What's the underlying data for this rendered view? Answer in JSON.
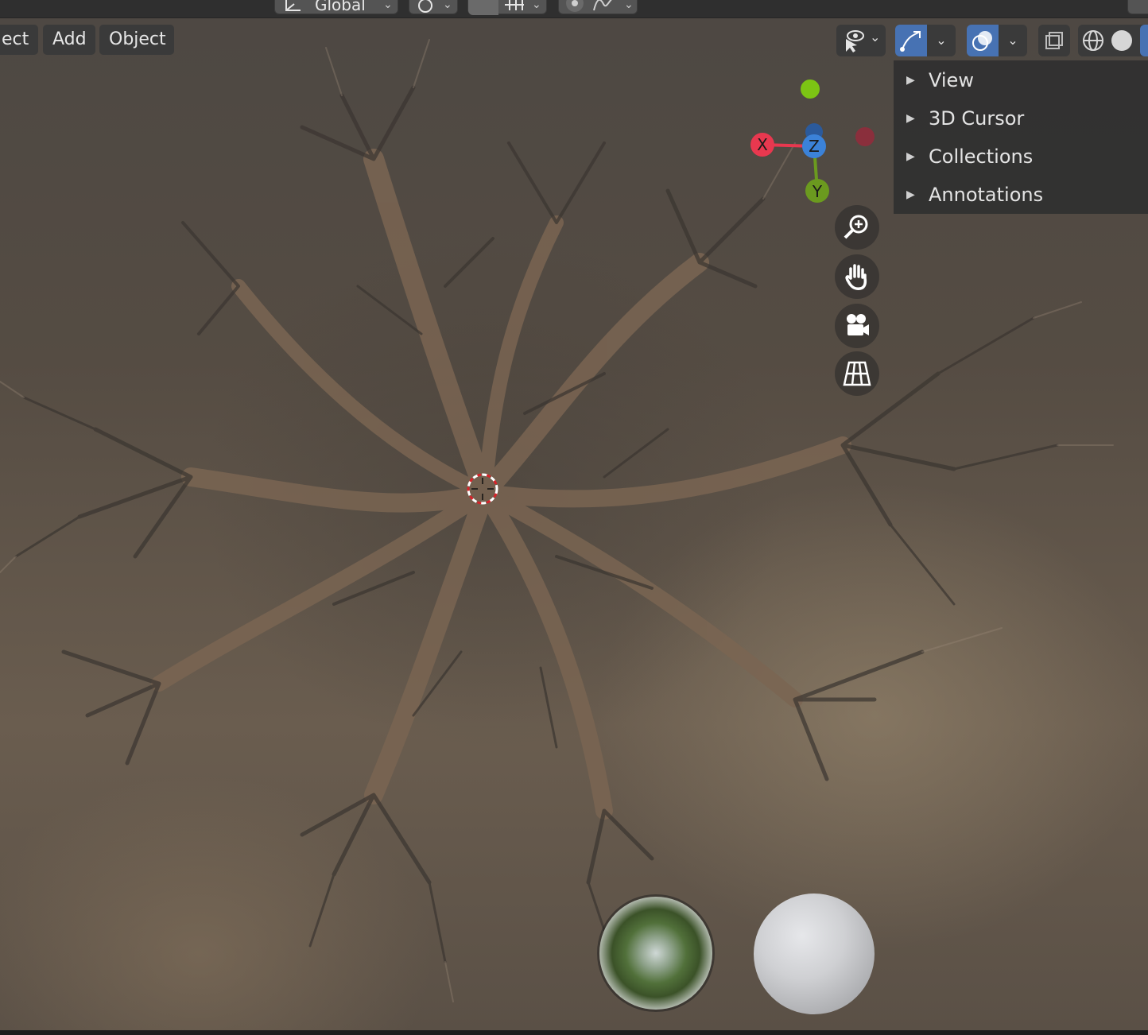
{
  "top_header": {
    "transform_orientation": "Global"
  },
  "menu": {
    "items": [
      "ect",
      "Add",
      "Object"
    ]
  },
  "sidebar": {
    "items": [
      {
        "label": "View"
      },
      {
        "label": "3D Cursor"
      },
      {
        "label": "Collections"
      },
      {
        "label": "Annotations"
      }
    ]
  },
  "gizmo": {
    "x_label": "X",
    "y_label": "Y",
    "z_label": "Z"
  },
  "colors": {
    "accent": "#4772b3",
    "axis_x": "#e8384f",
    "axis_y": "#6b9a1f",
    "axis_z": "#3b82d8"
  }
}
